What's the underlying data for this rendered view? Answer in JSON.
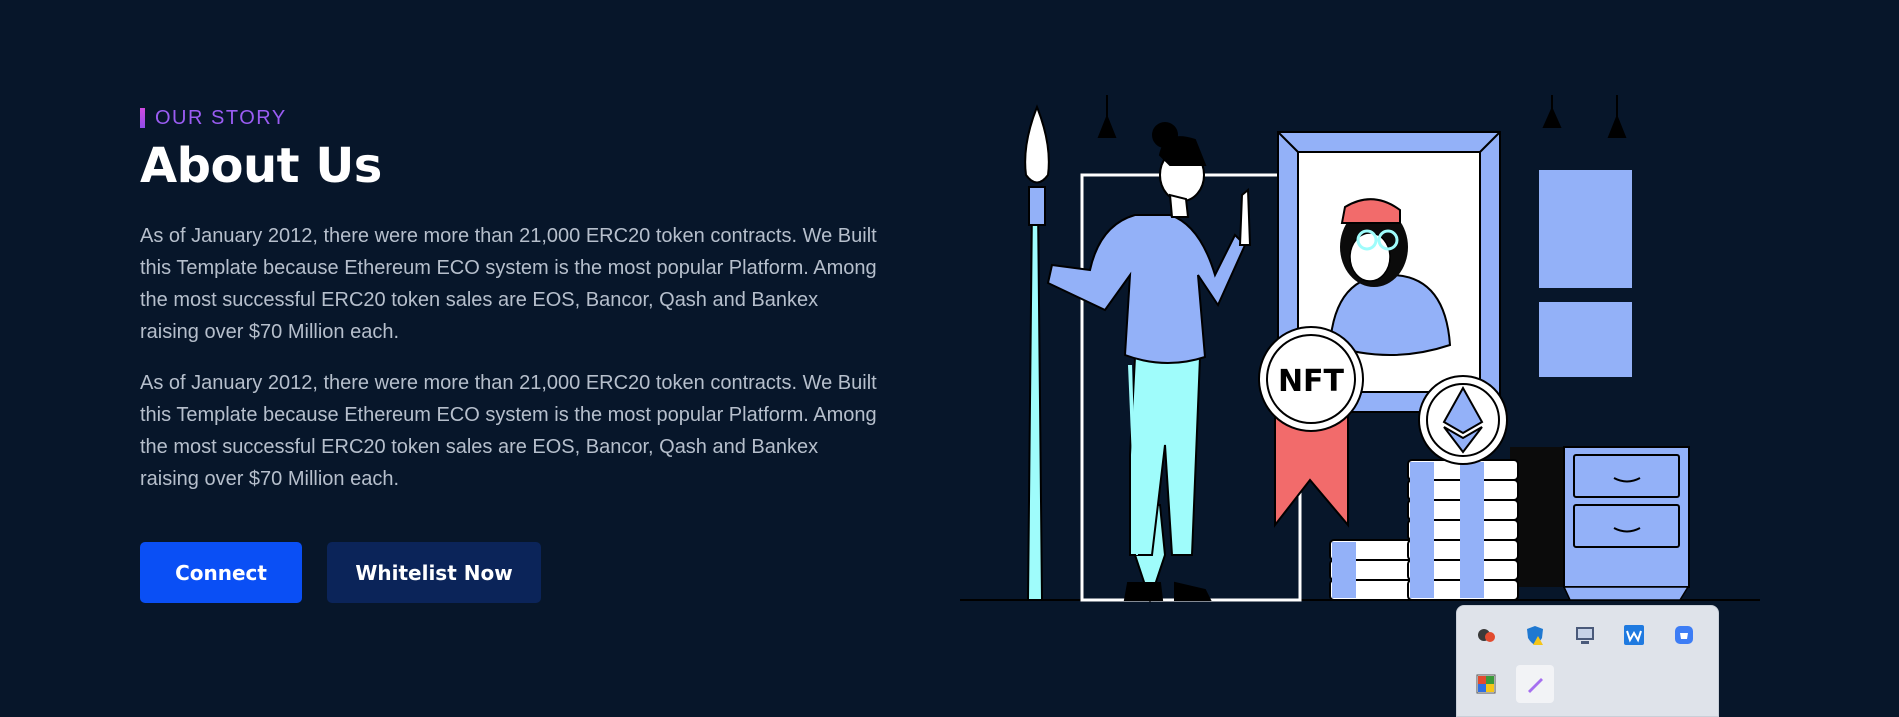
{
  "about": {
    "eyebrow": "OUR STORY",
    "title": "About Us",
    "paragraph1": "As of January 2012, there were more than 21,000 ERC20 token contracts. We Built this Template because Ethereum ECO system is the most popular Platform. Among the most successful ERC20 token sales are EOS, Bancor, Qash and Bankex raising over $70 Million each.",
    "paragraph2": "As of January 2012, there were more than 21,000 ERC20 token contracts. We Built this Template because Ethereum ECO system is the most popular Platform. Among the most successful ERC20 token sales are EOS, Bancor, Qash and Bankex raising over $70 Million each."
  },
  "buttons": {
    "connect": "Connect",
    "whitelist": "Whitelist Now"
  },
  "illustration": {
    "badge_text": "NFT"
  },
  "tray": {
    "icons": [
      "colorful-paint-icon",
      "shield-warning-icon",
      "monitor-icon",
      "waves-app-icon",
      "store-icon",
      "color-picker-icon",
      "pen-icon"
    ]
  },
  "colors": {
    "background": "#07162a",
    "accent": "#0a4ff5",
    "secondary_button": "#0b2459",
    "eyebrow": "#9a5cf2",
    "illustration_blue": "#93b1f8",
    "illustration_cyan": "#9ffcfb",
    "ribbon": "#f26b6b"
  }
}
